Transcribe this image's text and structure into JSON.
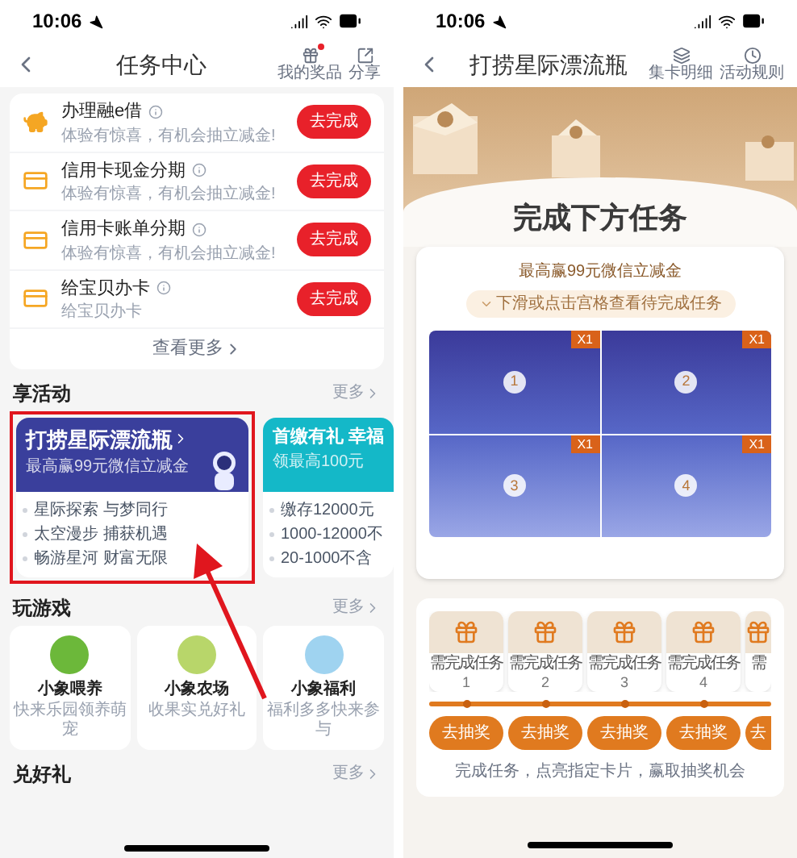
{
  "left": {
    "status": {
      "time": "10:06"
    },
    "nav": {
      "title": "任务中心",
      "actions": [
        {
          "label": "我的奖品",
          "kind": "gift",
          "badge": true
        },
        {
          "label": "分享",
          "kind": "share",
          "badge": false
        }
      ]
    },
    "tasks": [
      {
        "title": "办理融e借",
        "subtitle": "体验有惊喜，有机会抽立减金!",
        "button": "去完成",
        "kind": "piggy"
      },
      {
        "title": "信用卡现金分期",
        "subtitle": "体验有惊喜，有机会抽立减金!",
        "button": "去完成",
        "kind": "card"
      },
      {
        "title": "信用卡账单分期",
        "subtitle": "体验有惊喜，有机会抽立减金!",
        "button": "去完成",
        "kind": "card"
      },
      {
        "title": "给宝贝办卡",
        "subtitle": "给宝贝办卡",
        "button": "去完成",
        "kind": "card"
      }
    ],
    "tasks_more": "查看更多",
    "activities": {
      "title": "享活动",
      "more": "更多",
      "items": [
        {
          "title": "打捞星际漂流瓶",
          "subtitle": "最高赢99元微信立减金",
          "bullets": [
            "星际探索 与梦同行",
            "太空漫步 捕获机遇",
            "畅游星河 财富无限"
          ],
          "highlighted": true,
          "kind": "space",
          "color": "#3a3f9c"
        },
        {
          "title": "首缴有礼 幸福",
          "subtitle": "领最高100元",
          "bullets": [
            "缴存12000元",
            "1000-12000不",
            "20-1000不含"
          ],
          "highlighted": false,
          "kind": "plain",
          "color": "#14b8c8"
        }
      ]
    },
    "games": {
      "title": "玩游戏",
      "more": "更多",
      "items": [
        {
          "name": "小象喂养",
          "desc": "快来乐园领养萌宠",
          "color": "#6cb83a"
        },
        {
          "name": "小象农场",
          "desc": "收果实兑好礼",
          "color": "#b8d66a"
        },
        {
          "name": "小象福利",
          "desc": "福利多多快来参与",
          "color": "#9fd3f0"
        }
      ]
    },
    "gifts_section": {
      "title": "兑好礼",
      "more": "更多"
    }
  },
  "right": {
    "status": {
      "time": "10:06"
    },
    "nav": {
      "title": "打捞星际漂流瓶",
      "actions": [
        {
          "label": "集卡明细",
          "kind": "cards",
          "badge": false
        },
        {
          "label": "活动规则",
          "kind": "rules",
          "badge": false
        }
      ]
    },
    "heading": "完成下方任务",
    "prize": "最高赢99元微信立减金",
    "hint": "下滑或点击宫格查看待完成任务",
    "tiles": [
      {
        "number": "1",
        "badge": "X1"
      },
      {
        "number": "2",
        "badge": "X1"
      },
      {
        "number": "3",
        "badge": "X1"
      },
      {
        "number": "4",
        "badge": "X1"
      }
    ],
    "rewards": [
      {
        "label": "需完成任务",
        "number": "1",
        "button": "去抽奖"
      },
      {
        "label": "需完成任务",
        "number": "2",
        "button": "去抽奖"
      },
      {
        "label": "需完成任务",
        "number": "3",
        "button": "去抽奖"
      },
      {
        "label": "需完成任务",
        "number": "4",
        "button": "去抽奖"
      },
      {
        "label": "需",
        "button": "去"
      }
    ],
    "footer": "完成任务，点亮指定卡片，赢取抽奖机会"
  }
}
